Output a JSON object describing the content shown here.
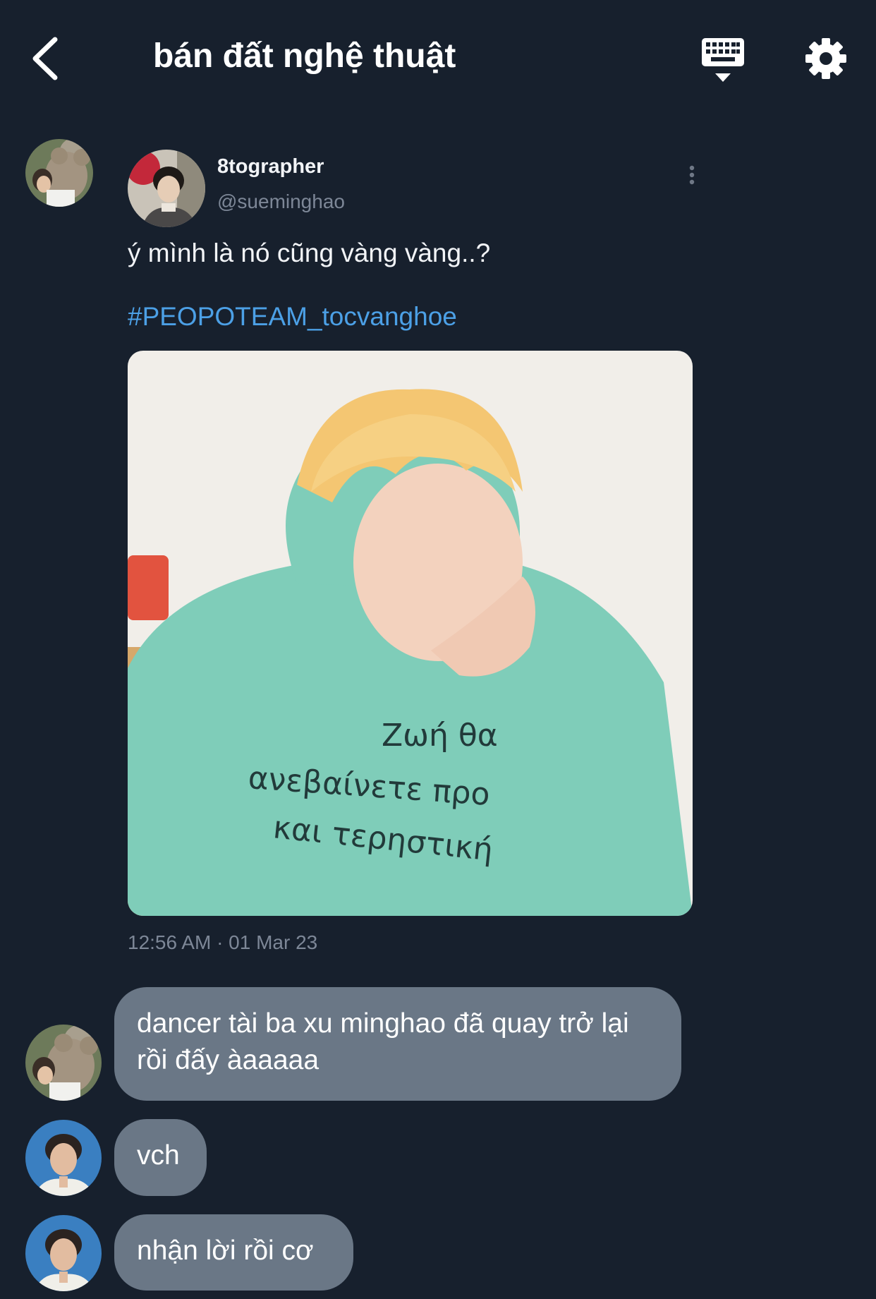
{
  "header": {
    "title": "bán đất nghệ thuật",
    "back_icon": "chevron-left-icon",
    "keyboard_icon": "keyboard-icon",
    "settings_icon": "gear-icon"
  },
  "shared_post": {
    "display_name": "8tographer",
    "handle": "@sueminghao",
    "text": "ý mình là nó cũng vàng vàng..?",
    "hashtag": "#PEOPOTEAM_tocvanghoe",
    "image_text": "Ζωή θα\nανεβαίνετε προ\nκαι τερηστική",
    "timestamp": "12:56 AM · 01 Mar 23"
  },
  "messages": [
    {
      "text": "dancer tài ba xu minghao đã quay trở lại rồi đấy àaaaaa"
    },
    {
      "text": "vch"
    },
    {
      "text": "nhận lời rồi cơ"
    }
  ],
  "colors": {
    "background": "#17202d",
    "bubble": "#6a7786",
    "link": "#4ca0e6",
    "muted": "#7d8797"
  }
}
